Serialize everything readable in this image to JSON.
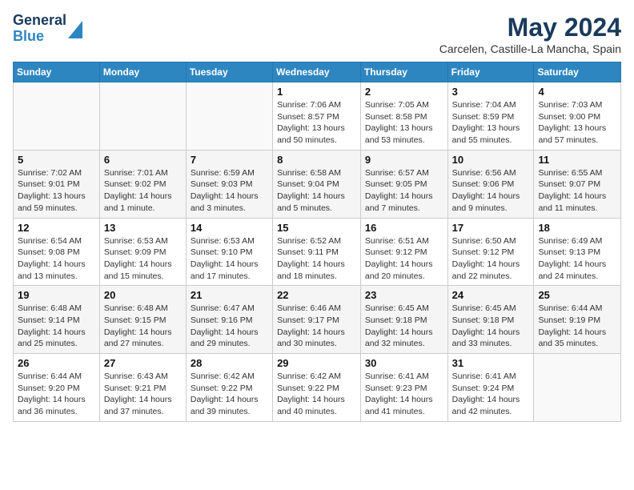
{
  "header": {
    "logo_line1": "General",
    "logo_line2": "Blue",
    "title": "May 2024",
    "subtitle": "Carcelen, Castille-La Mancha, Spain"
  },
  "weekdays": [
    "Sunday",
    "Monday",
    "Tuesday",
    "Wednesday",
    "Thursday",
    "Friday",
    "Saturday"
  ],
  "weeks": [
    [
      {
        "day": "",
        "content": ""
      },
      {
        "day": "",
        "content": ""
      },
      {
        "day": "",
        "content": ""
      },
      {
        "day": "1",
        "content": "Sunrise: 7:06 AM\nSunset: 8:57 PM\nDaylight: 13 hours\nand 50 minutes."
      },
      {
        "day": "2",
        "content": "Sunrise: 7:05 AM\nSunset: 8:58 PM\nDaylight: 13 hours\nand 53 minutes."
      },
      {
        "day": "3",
        "content": "Sunrise: 7:04 AM\nSunset: 8:59 PM\nDaylight: 13 hours\nand 55 minutes."
      },
      {
        "day": "4",
        "content": "Sunrise: 7:03 AM\nSunset: 9:00 PM\nDaylight: 13 hours\nand 57 minutes."
      }
    ],
    [
      {
        "day": "5",
        "content": "Sunrise: 7:02 AM\nSunset: 9:01 PM\nDaylight: 13 hours\nand 59 minutes."
      },
      {
        "day": "6",
        "content": "Sunrise: 7:01 AM\nSunset: 9:02 PM\nDaylight: 14 hours\nand 1 minute."
      },
      {
        "day": "7",
        "content": "Sunrise: 6:59 AM\nSunset: 9:03 PM\nDaylight: 14 hours\nand 3 minutes."
      },
      {
        "day": "8",
        "content": "Sunrise: 6:58 AM\nSunset: 9:04 PM\nDaylight: 14 hours\nand 5 minutes."
      },
      {
        "day": "9",
        "content": "Sunrise: 6:57 AM\nSunset: 9:05 PM\nDaylight: 14 hours\nand 7 minutes."
      },
      {
        "day": "10",
        "content": "Sunrise: 6:56 AM\nSunset: 9:06 PM\nDaylight: 14 hours\nand 9 minutes."
      },
      {
        "day": "11",
        "content": "Sunrise: 6:55 AM\nSunset: 9:07 PM\nDaylight: 14 hours\nand 11 minutes."
      }
    ],
    [
      {
        "day": "12",
        "content": "Sunrise: 6:54 AM\nSunset: 9:08 PM\nDaylight: 14 hours\nand 13 minutes."
      },
      {
        "day": "13",
        "content": "Sunrise: 6:53 AM\nSunset: 9:09 PM\nDaylight: 14 hours\nand 15 minutes."
      },
      {
        "day": "14",
        "content": "Sunrise: 6:53 AM\nSunset: 9:10 PM\nDaylight: 14 hours\nand 17 minutes."
      },
      {
        "day": "15",
        "content": "Sunrise: 6:52 AM\nSunset: 9:11 PM\nDaylight: 14 hours\nand 18 minutes."
      },
      {
        "day": "16",
        "content": "Sunrise: 6:51 AM\nSunset: 9:12 PM\nDaylight: 14 hours\nand 20 minutes."
      },
      {
        "day": "17",
        "content": "Sunrise: 6:50 AM\nSunset: 9:12 PM\nDaylight: 14 hours\nand 22 minutes."
      },
      {
        "day": "18",
        "content": "Sunrise: 6:49 AM\nSunset: 9:13 PM\nDaylight: 14 hours\nand 24 minutes."
      }
    ],
    [
      {
        "day": "19",
        "content": "Sunrise: 6:48 AM\nSunset: 9:14 PM\nDaylight: 14 hours\nand 25 minutes."
      },
      {
        "day": "20",
        "content": "Sunrise: 6:48 AM\nSunset: 9:15 PM\nDaylight: 14 hours\nand 27 minutes."
      },
      {
        "day": "21",
        "content": "Sunrise: 6:47 AM\nSunset: 9:16 PM\nDaylight: 14 hours\nand 29 minutes."
      },
      {
        "day": "22",
        "content": "Sunrise: 6:46 AM\nSunset: 9:17 PM\nDaylight: 14 hours\nand 30 minutes."
      },
      {
        "day": "23",
        "content": "Sunrise: 6:45 AM\nSunset: 9:18 PM\nDaylight: 14 hours\nand 32 minutes."
      },
      {
        "day": "24",
        "content": "Sunrise: 6:45 AM\nSunset: 9:18 PM\nDaylight: 14 hours\nand 33 minutes."
      },
      {
        "day": "25",
        "content": "Sunrise: 6:44 AM\nSunset: 9:19 PM\nDaylight: 14 hours\nand 35 minutes."
      }
    ],
    [
      {
        "day": "26",
        "content": "Sunrise: 6:44 AM\nSunset: 9:20 PM\nDaylight: 14 hours\nand 36 minutes."
      },
      {
        "day": "27",
        "content": "Sunrise: 6:43 AM\nSunset: 9:21 PM\nDaylight: 14 hours\nand 37 minutes."
      },
      {
        "day": "28",
        "content": "Sunrise: 6:42 AM\nSunset: 9:22 PM\nDaylight: 14 hours\nand 39 minutes."
      },
      {
        "day": "29",
        "content": "Sunrise: 6:42 AM\nSunset: 9:22 PM\nDaylight: 14 hours\nand 40 minutes."
      },
      {
        "day": "30",
        "content": "Sunrise: 6:41 AM\nSunset: 9:23 PM\nDaylight: 14 hours\nand 41 minutes."
      },
      {
        "day": "31",
        "content": "Sunrise: 6:41 AM\nSunset: 9:24 PM\nDaylight: 14 hours\nand 42 minutes."
      },
      {
        "day": "",
        "content": ""
      }
    ]
  ]
}
